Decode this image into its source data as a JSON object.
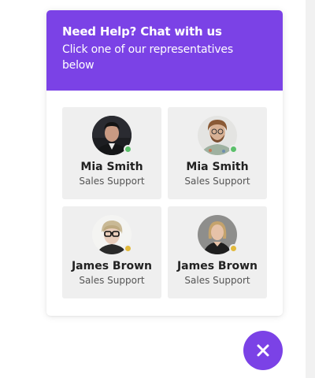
{
  "header": {
    "title": "Need Help? Chat with us",
    "subtitle": "Click one of our representatives below"
  },
  "agents": [
    {
      "name": "Mia Smith",
      "role": "Sales Support",
      "status": "online",
      "status_color": "#5cc06b"
    },
    {
      "name": "Mia Smith",
      "role": "Sales Support",
      "status": "online",
      "status_color": "#5cc06b"
    },
    {
      "name": "James Brown",
      "role": "Sales Support",
      "status": "away",
      "status_color": "#e2b93b"
    },
    {
      "name": "James Brown",
      "role": "Sales Support",
      "status": "away",
      "status_color": "#e2b93b"
    }
  ],
  "close_button": {
    "icon": "close-icon"
  },
  "colors": {
    "accent": "#7b42e6",
    "card_bg": "#efefef"
  }
}
